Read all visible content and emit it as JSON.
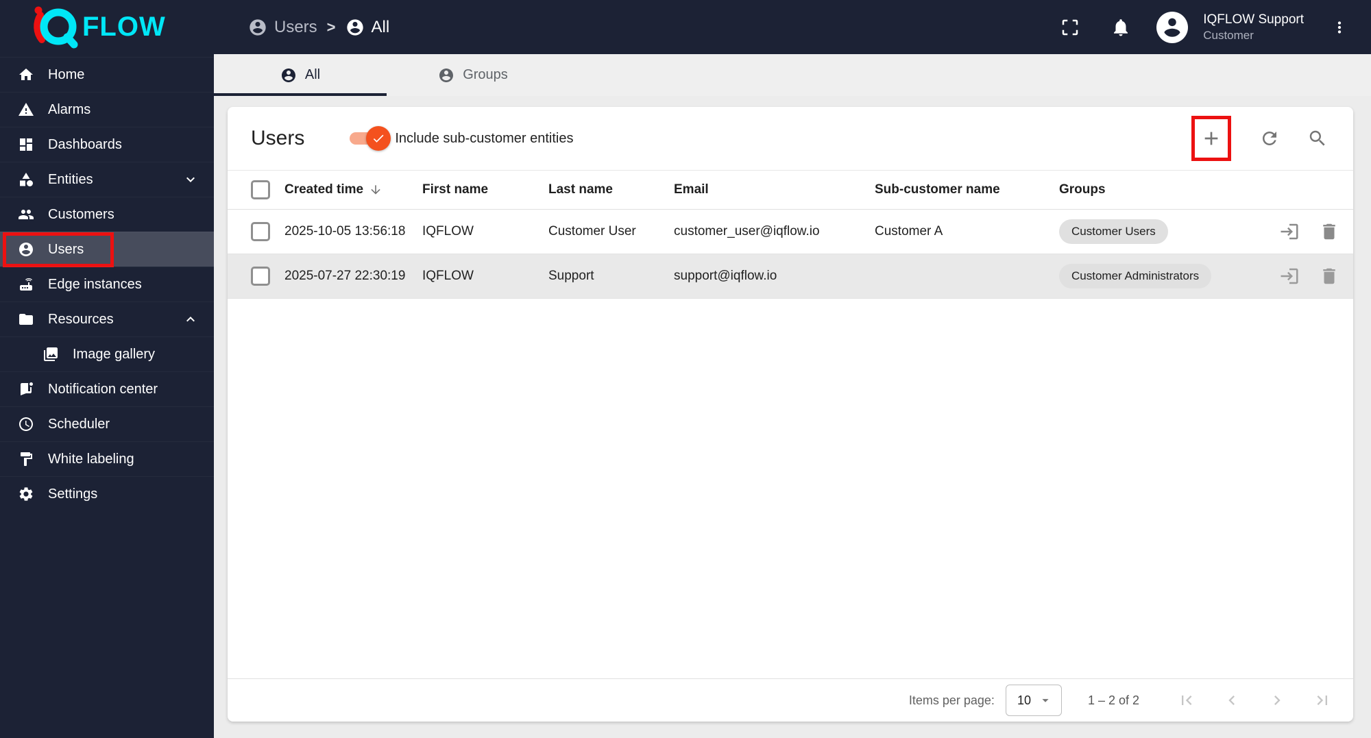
{
  "brand": {
    "name": "FLOW",
    "accent_cyan": "#00e7f7",
    "accent_red": "#ec1111"
  },
  "topbar": {
    "breadcrumb": {
      "section": "Users",
      "separator": ">",
      "page": "All"
    },
    "user": {
      "name": "IQFLOW Support",
      "role": "Customer"
    }
  },
  "sidebar": {
    "items": [
      {
        "label": "Home"
      },
      {
        "label": "Alarms"
      },
      {
        "label": "Dashboards"
      },
      {
        "label": "Entities"
      },
      {
        "label": "Customers"
      },
      {
        "label": "Users"
      },
      {
        "label": "Edge instances"
      },
      {
        "label": "Resources"
      },
      {
        "label": "Image gallery"
      },
      {
        "label": "Notification center"
      },
      {
        "label": "Scheduler"
      },
      {
        "label": "White labeling"
      },
      {
        "label": "Settings"
      }
    ]
  },
  "tabs": {
    "all": "All",
    "groups": "Groups"
  },
  "panel": {
    "title": "Users",
    "toggle_label": "Include sub-customer entities",
    "toggle_on": true,
    "toggle_color": "#f4511e"
  },
  "table": {
    "columns": [
      "Created time",
      "First name",
      "Last name",
      "Email",
      "Sub-customer name",
      "Groups"
    ],
    "rows": [
      {
        "created": "2025-10-05 13:56:18",
        "first": "IQFLOW",
        "last": "Customer User",
        "email": "customer_user@iqflow.io",
        "subcustomer": "Customer A",
        "group": "Customer Users"
      },
      {
        "created": "2025-07-27 22:30:19",
        "first": "IQFLOW",
        "last": "Support",
        "email": "support@iqflow.io",
        "subcustomer": "",
        "group": "Customer Administrators"
      }
    ]
  },
  "pagination": {
    "items_per_page_label": "Items per page:",
    "page_size": "10",
    "range_label": "1 – 2 of 2"
  }
}
